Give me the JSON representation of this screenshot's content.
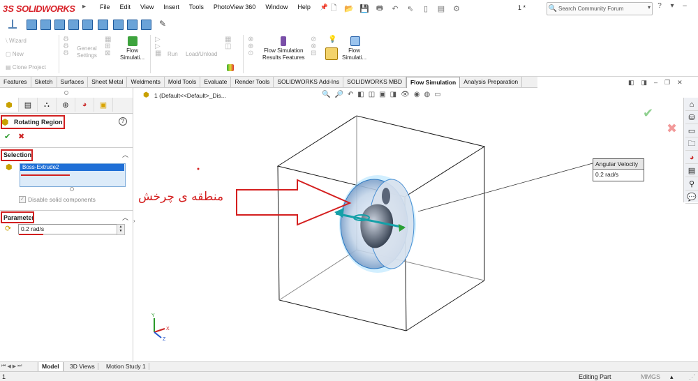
{
  "app": {
    "logo_ds": "3S",
    "logo_name": "SOLIDWORKS"
  },
  "menu": [
    "File",
    "Edit",
    "View",
    "Insert",
    "Tools",
    "PhotoView 360",
    "Window",
    "Help"
  ],
  "rebuild_count": "1 *",
  "search": {
    "placeholder": "Search Community Forum"
  },
  "command_manager": {
    "wizard": "Wizard",
    "new": "New",
    "clone_project": "Clone Project",
    "general_settings_1": "General",
    "general_settings_2": "Settings",
    "flow_simulation_1": "Flow",
    "flow_simulation_2": "Simulati...",
    "run": "Run",
    "load_unload": "Load/Unload",
    "results_features_1": "Flow Simulation",
    "results_features_2": "Results Features",
    "flow_sim2_1": "Flow",
    "flow_sim2_2": "Simulati..."
  },
  "tabs": [
    "Features",
    "Sketch",
    "Surfaces",
    "Sheet Metal",
    "Weldments",
    "Mold Tools",
    "Evaluate",
    "Render Tools",
    "SOLIDWORKS Add-Ins",
    "SOLIDWORKS MBD",
    "Flow Simulation",
    "Analysis Preparation"
  ],
  "active_tab": "Flow Simulation",
  "property_manager": {
    "title": "Rotating Region",
    "help": "?",
    "selection_header": "Selection",
    "selected_item": "Boss-Extrude2",
    "disable_solid": "Disable solid components",
    "parameter_header": "Parameter",
    "parameter_value": "0.2 rad/s"
  },
  "tree": {
    "index": "1",
    "config": "(Default<<Default>_Dis..."
  },
  "callout": {
    "header": "Angular Velocity",
    "value": "0.2 rad/s"
  },
  "annotation_text": "منطقه ی چرخش",
  "triad": {
    "x": "X",
    "y": "Y",
    "z": "Z"
  },
  "bottom_tabs": [
    "Model",
    "3D Views",
    "Motion Study 1"
  ],
  "active_bottom_tab": "Model",
  "status": {
    "left": "1",
    "mode": "Editing Part",
    "units": "MMGS"
  },
  "colors": {
    "brand_red": "#d8232a",
    "annotation_red": "#d41f1f",
    "selection_blue": "#1f6fd6",
    "region_cyan": "#7fd0ff"
  }
}
